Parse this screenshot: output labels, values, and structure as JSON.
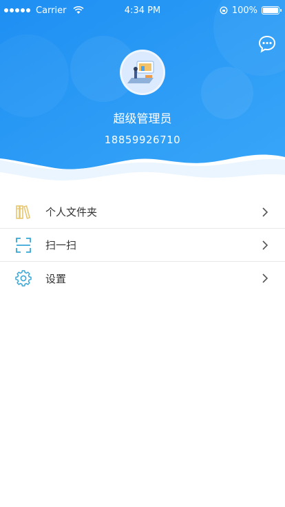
{
  "status_bar": {
    "carrier": "Carrier",
    "time": "4:34 PM",
    "battery": "100%"
  },
  "profile": {
    "name": "超级管理员",
    "phone": "18859926710"
  },
  "menu": {
    "items": [
      {
        "label": "个人文件夹",
        "icon": "folder-books-icon"
      },
      {
        "label": "扫一扫",
        "icon": "scan-icon"
      },
      {
        "label": "设置",
        "icon": "gear-icon"
      }
    ]
  },
  "colors": {
    "header_blue": "#2a96f6",
    "accent_gold": "#e8c66c",
    "accent_cyan": "#36a6d6"
  }
}
